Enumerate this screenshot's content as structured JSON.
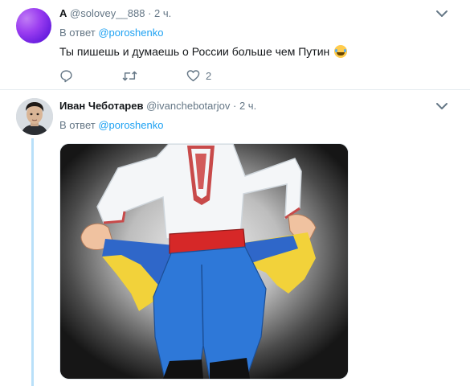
{
  "tweets": [
    {
      "name": "A",
      "handle": "@solovey__888",
      "separator": "·",
      "time": "2 ч.",
      "reply_prefix": "В ответ",
      "reply_to": "@poroshenko",
      "text": "Ты пишешь и думаешь о России больше чем Путин",
      "emoji": "face-with-tears-of-joy",
      "actions": {
        "reply_count": "",
        "retweet_count": "",
        "like_count": "2"
      },
      "avatar_color": "#9a3df0"
    },
    {
      "name": "Иван Чеботарев",
      "handle": "@ivanchebotarjov",
      "separator": "·",
      "time": "2 ч.",
      "reply_prefix": "В ответ",
      "reply_to": "@poroshenko",
      "media": {
        "type": "illustration"
      }
    }
  ],
  "icons": [
    "reply-icon",
    "retweet-icon",
    "like-icon",
    "chevron-down-icon"
  ],
  "colors": {
    "link": "#1da1f2",
    "muted": "#657786",
    "thread_line": "#b9e0f9",
    "text": "#14171a"
  }
}
